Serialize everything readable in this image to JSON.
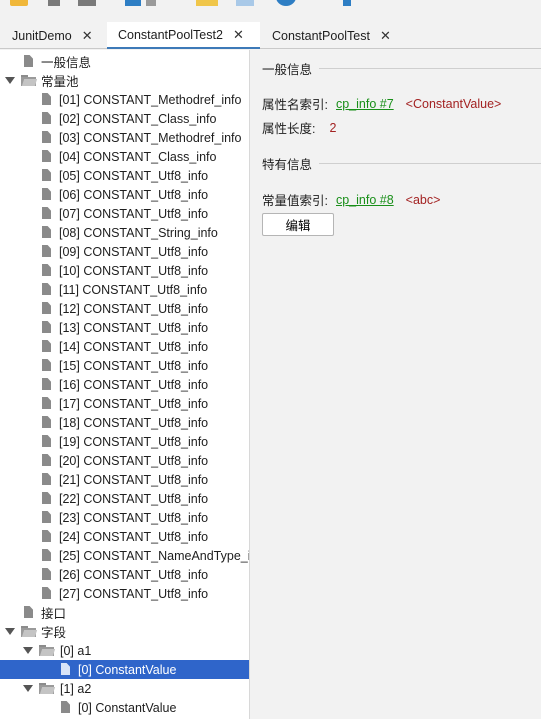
{
  "toolbar": {
    "icons": [
      "folder-icon",
      "tool-icon",
      "arrows-icon",
      "copy-icon",
      "list-icon",
      "open-folder-icon",
      "document-icon",
      "info-icon",
      "arrow-icon"
    ]
  },
  "tabs": [
    {
      "label": "JunitDemo",
      "close": "✕"
    },
    {
      "label": "ConstantPoolTest2",
      "close": "✕"
    },
    {
      "label": "ConstantPoolTest",
      "close": "✕"
    }
  ],
  "tree": {
    "nodes": [
      {
        "label": "一般信息",
        "icon": "file-icon"
      },
      {
        "label": "常量池",
        "icon": "folder-icon"
      },
      {
        "label": "[01] CONSTANT_Methodref_info",
        "icon": "file-icon"
      },
      {
        "label": "[02] CONSTANT_Class_info",
        "icon": "file-icon"
      },
      {
        "label": "[03] CONSTANT_Methodref_info",
        "icon": "file-icon"
      },
      {
        "label": "[04] CONSTANT_Class_info",
        "icon": "file-icon"
      },
      {
        "label": "[05] CONSTANT_Utf8_info",
        "icon": "file-icon"
      },
      {
        "label": "[06] CONSTANT_Utf8_info",
        "icon": "file-icon"
      },
      {
        "label": "[07] CONSTANT_Utf8_info",
        "icon": "file-icon"
      },
      {
        "label": "[08] CONSTANT_String_info",
        "icon": "file-icon"
      },
      {
        "label": "[09] CONSTANT_Utf8_info",
        "icon": "file-icon"
      },
      {
        "label": "[10] CONSTANT_Utf8_info",
        "icon": "file-icon"
      },
      {
        "label": "[11] CONSTANT_Utf8_info",
        "icon": "file-icon"
      },
      {
        "label": "[12] CONSTANT_Utf8_info",
        "icon": "file-icon"
      },
      {
        "label": "[13] CONSTANT_Utf8_info",
        "icon": "file-icon"
      },
      {
        "label": "[14] CONSTANT_Utf8_info",
        "icon": "file-icon"
      },
      {
        "label": "[15] CONSTANT_Utf8_info",
        "icon": "file-icon"
      },
      {
        "label": "[16] CONSTANT_Utf8_info",
        "icon": "file-icon"
      },
      {
        "label": "[17] CONSTANT_Utf8_info",
        "icon": "file-icon"
      },
      {
        "label": "[18] CONSTANT_Utf8_info",
        "icon": "file-icon"
      },
      {
        "label": "[19] CONSTANT_Utf8_info",
        "icon": "file-icon"
      },
      {
        "label": "[20] CONSTANT_Utf8_info",
        "icon": "file-icon"
      },
      {
        "label": "[21] CONSTANT_Utf8_info",
        "icon": "file-icon"
      },
      {
        "label": "[22] CONSTANT_Utf8_info",
        "icon": "file-icon"
      },
      {
        "label": "[23] CONSTANT_Utf8_info",
        "icon": "file-icon"
      },
      {
        "label": "[24] CONSTANT_Utf8_info",
        "icon": "file-icon"
      },
      {
        "label": "[25] CONSTANT_NameAndType_i",
        "icon": "file-icon"
      },
      {
        "label": "[26] CONSTANT_Utf8_info",
        "icon": "file-icon"
      },
      {
        "label": "[27] CONSTANT_Utf8_info",
        "icon": "file-icon"
      },
      {
        "label": "接口",
        "icon": "file-icon"
      },
      {
        "label": "字段",
        "icon": "folder-icon"
      },
      {
        "label": "[0] a1",
        "icon": "folder-icon"
      },
      {
        "label": "[0] ConstantValue",
        "icon": "file-icon",
        "selected": true
      },
      {
        "label": "[1] a2",
        "icon": "folder-icon"
      },
      {
        "label": "[0] ConstantValue",
        "icon": "file-icon"
      }
    ]
  },
  "panel": {
    "general_section": "一般信息",
    "attr_name_index_label": "属性名索引:",
    "attr_name_index_link": "cp_info #7",
    "attr_name_index_tag": "<ConstantValue>",
    "attr_length_label": "属性长度:",
    "attr_length_value": "2",
    "specific_section": "特有信息",
    "const_value_index_label": "常量值索引:",
    "const_value_index_link": "cp_info #8",
    "const_value_index_tag": "<abc>",
    "edit_button": "编辑"
  },
  "colors": {
    "selection": "#2f65ca",
    "link": "#198f19",
    "tag": "#a32222",
    "active_tab_underline": "#3d7ab8"
  }
}
